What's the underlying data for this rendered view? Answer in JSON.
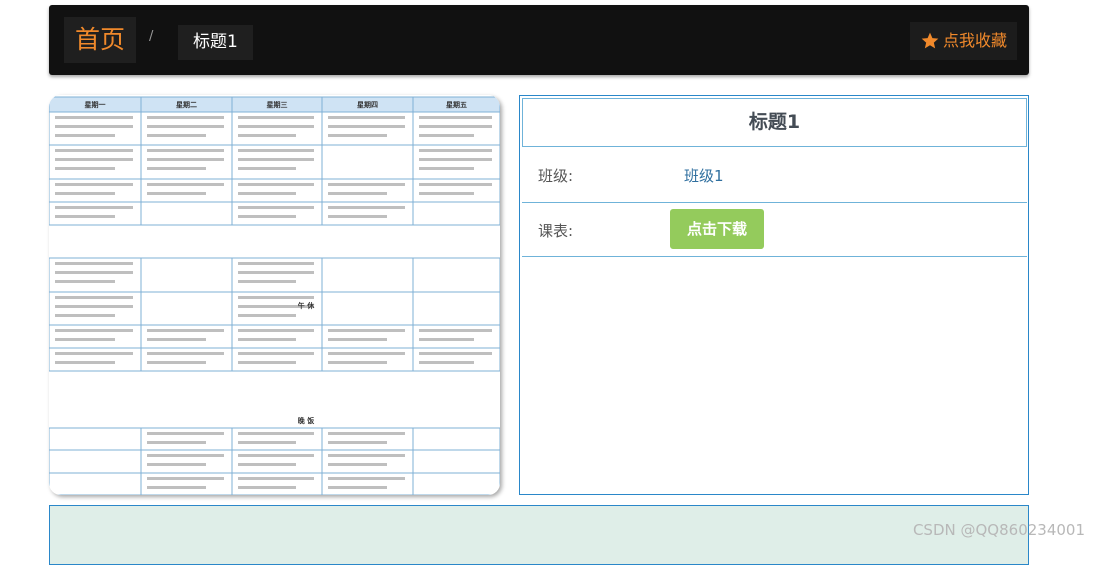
{
  "breadcrumb": {
    "home": "首页",
    "separator": "/",
    "current": "标题1"
  },
  "favorite": {
    "icon": "star-icon",
    "label": "点我收藏"
  },
  "timetable_image": {
    "description_icon": "timetable-image",
    "headers": [
      "星期一",
      "星期二",
      "星期三",
      "星期四",
      "星期五"
    ],
    "sections": [
      "午 休",
      "晚 饭"
    ]
  },
  "info": {
    "title": "标题1",
    "class_label": "班级:",
    "class_value": "班级1",
    "schedule_label": "课表:",
    "download_label": "点击下载"
  },
  "watermark": "CSDN @QQ860234001",
  "colors": {
    "accent": "#f0892b",
    "border": "#2a87c9",
    "download": "#94cb5c",
    "bottom_bg": "#dfeee8"
  }
}
